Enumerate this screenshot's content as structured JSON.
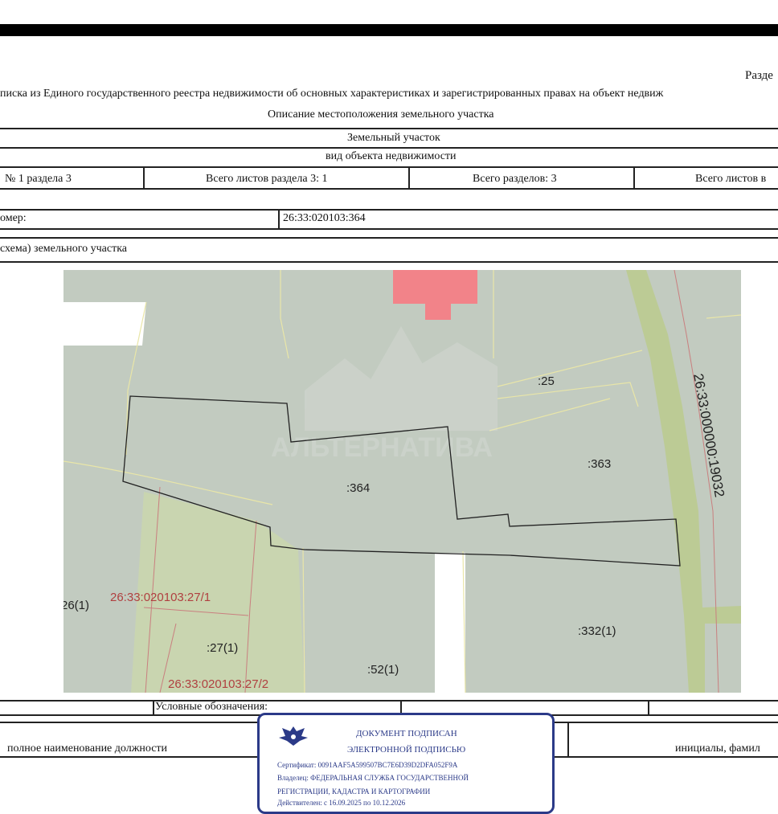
{
  "header": {
    "section_label": "Разде",
    "title": "писка из Единого государственного реестра недвижимости об основных характеристиках и зарегистрированных правах на объект недвиж",
    "subtitle": "Описание местоположения земельного участка"
  },
  "object": {
    "type": "Земельный участок",
    "type_caption": "вид объекта недвижимости"
  },
  "sheet_info": {
    "sheet": "№ 1 раздела 3",
    "sheets_in_section": "Всего листов раздела 3: 1",
    "sections_total": "Всего разделов: 3",
    "sheets_total": "Всего листов в"
  },
  "cadastral": {
    "label": "омер:",
    "value": "26:33:020103:364"
  },
  "scheme_label": "схема) земельного участка",
  "map": {
    "watermark": "АЛЬТЕРНАТИВА",
    "labels": {
      "p25": ":25",
      "p363": ":363",
      "p364": ":364",
      "road": "26:33:000000:19032",
      "p26": "26(1)",
      "p27_1": "26:33:020103:27/1",
      "p27": ":27(1)",
      "p332": ":332(1)",
      "p52": ":52(1)",
      "p27_2": "26:33:020103:27/2"
    }
  },
  "legend_label": "Условные обозначения:",
  "signature_row": {
    "position": "полное наименование должности",
    "initials": "инициалы, фамил"
  },
  "stamp": {
    "line1": "ДОКУМЕНТ ПОДПИСАН",
    "line2": "ЭЛЕКТРОННОЙ ПОДПИСЬЮ",
    "certificate": "Сертификат: 0091AAF5A599507BC7E6D39D2DFA052F9A",
    "owner1": "Владелец: ФЕДЕРАЛЬНАЯ СЛУЖБА ГОСУДАРСТВЕННОЙ",
    "owner2": "РЕГИСТРАЦИИ, КАДАСТРА И КАРТОГРАФИИ",
    "valid": "Действителен: с 16.09.2025 по 10.12.2026"
  },
  "colors": {
    "map_background": "#c2cbc0",
    "parcel_green": "#c9d5b0",
    "road": "#bccb95",
    "building": "#f07a80",
    "stamp_blue": "#2b3a88",
    "label_red": "#b04040"
  }
}
